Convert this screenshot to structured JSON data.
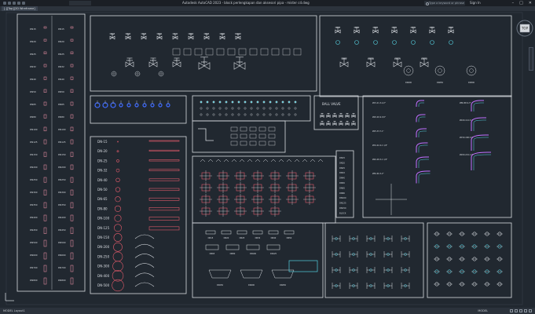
{
  "titlebar": {
    "title": "Autodesk AutoCAD 2023 - block perlengkapan dan aksesori pipa - mister cd.dwg",
    "workspace": "",
    "search_placeholder": "Type a keyword or phrase",
    "signin": "Sign In"
  },
  "doc_tab": {
    "label": "[-][Top][2D Wireframe]"
  },
  "status": {
    "left": "MODEL   Layout1",
    "right": "MODEL"
  },
  "viewcube": {
    "label": "TOP"
  },
  "colors": {
    "background": "#212830",
    "frame": "#d9dde2",
    "red": "#e05a6a",
    "pink": "#ff9ab0",
    "cyan": "#55d0e0",
    "blue": "#3f6bff",
    "magenta": "#c070ff",
    "yellow": "#e6e26a"
  },
  "panels": {
    "schedule_left": {
      "rows": [
        "DN15-15",
        "DN20-20",
        "DN25-25",
        "DN32-32",
        "DN40-40",
        "DN50-50",
        "DN65-65",
        "DN80-80",
        "DN100-100",
        "DN125-125",
        "DN150-150",
        "DN200-200",
        "DN250-250",
        "DN300-300",
        "DN350-350",
        "DN400-400",
        "DN450-450",
        "DN500-500",
        "DN600-600",
        "DN700-700",
        "DN800-800"
      ]
    },
    "valves_top": {
      "row1": [
        "DN15",
        "DN20",
        "DN25",
        "DN32",
        "DN40",
        "DN50",
        "DN65",
        "DN80",
        "DN100"
      ],
      "row2": [
        "DN125",
        "DN150",
        "DN200"
      ],
      "row3": [
        "DN250",
        "DN300"
      ]
    },
    "valves_right": {
      "row1": [
        "DN15",
        "DN20",
        "DN25",
        "DN32",
        "DN40",
        "DN50",
        "DN65"
      ],
      "row2": [
        "DN80",
        "DN100",
        "DN125",
        "DN150"
      ],
      "row3": [
        "DN200",
        "DN250",
        "DN300"
      ]
    },
    "ball_valve": {
      "title": "BALL VALVE"
    },
    "pipe_sizes": [
      "DN-15",
      "DN-20",
      "DN-25",
      "DN-32",
      "DN-40",
      "DN-50",
      "DN-65",
      "DN-80",
      "DN-100",
      "DN-125",
      "DN-150",
      "DN-200",
      "DN-250",
      "DN-300",
      "DN-400",
      "DN-500"
    ],
    "elbow_labels": [
      "Ø15-21.3-1/2\"",
      "Ø20-26.9-3/4\"",
      "Ø25-33.7-1\"",
      "Ø32-42.4-1 1/4\"",
      "Ø40-48.3-1 1/2\"",
      "Ø50-60.3-2\"",
      "Ø80-88.9-3\"",
      "Ø100-114.3-4\"",
      "Ø150-168.3-6\"",
      "Ø200-219.1-8\""
    ],
    "flange_labels": [
      "DN15",
      "DN20",
      "DN25",
      "DN32",
      "DN40",
      "DN50",
      "DN65",
      "DN80",
      "DN100",
      "DN125",
      "DN150",
      "DN200",
      "DN250"
    ],
    "small_stack": [
      "DN15",
      "DN20",
      "DN25",
      "DN32",
      "DN40",
      "DN50",
      "DN65",
      "DN80",
      "DN100",
      "DN125",
      "DN150",
      "BLOCK"
    ]
  }
}
